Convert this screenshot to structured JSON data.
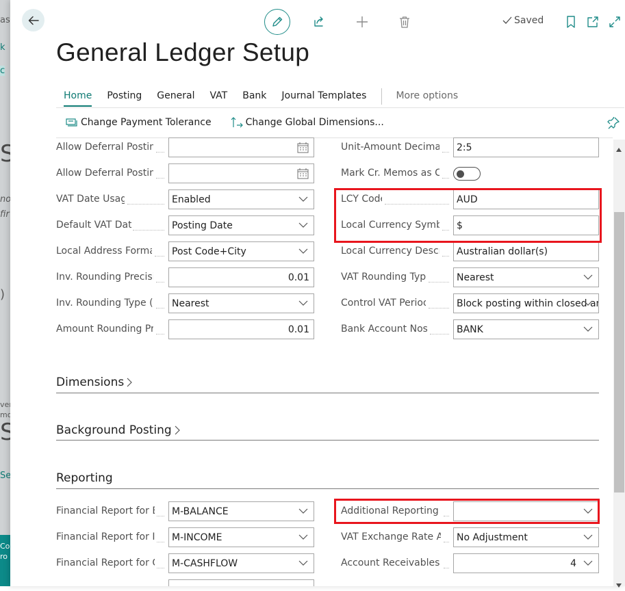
{
  "background": {
    "fragments": [
      "asl",
      "k",
      "c",
      "S",
      "no",
      "fir",
      ")",
      "ver",
      "mo",
      "S",
      "Se",
      "Co",
      "ro"
    ]
  },
  "header": {
    "saved_label": "Saved",
    "title": "General Ledger Setup"
  },
  "tabs": [
    {
      "label": "Home"
    },
    {
      "label": "Posting"
    },
    {
      "label": "General"
    },
    {
      "label": "VAT"
    },
    {
      "label": "Bank"
    },
    {
      "label": "Journal Templates"
    }
  ],
  "more_options": "More options",
  "actions": {
    "change_payment_tolerance": "Change Payment Tolerance",
    "change_global_dimensions": "Change Global Dimensions..."
  },
  "general_left": [
    {
      "label": "Allow Deferral Postin...",
      "value": "",
      "control": "date"
    },
    {
      "label": "Allow Deferral Postin...",
      "value": "",
      "control": "date"
    },
    {
      "label": "VAT Date Usage",
      "value": "Enabled",
      "control": "select"
    },
    {
      "label": "Default VAT Date",
      "value": "Posting Date",
      "control": "select"
    },
    {
      "label": "Local Address Format",
      "value": "Post Code+City",
      "control": "select"
    },
    {
      "label": "Inv. Rounding Precisi...",
      "value": "0.01",
      "control": "number"
    },
    {
      "label": "Inv. Rounding Type (L...",
      "value": "Nearest",
      "control": "select"
    },
    {
      "label": "Amount Rounding Pr...",
      "value": "0.01",
      "control": "number"
    }
  ],
  "general_right": [
    {
      "label": "Unit-Amount Decima...",
      "value": "2:5",
      "control": "text"
    },
    {
      "label": "Mark Cr. Memos as C...",
      "value": "",
      "control": "toggle"
    },
    {
      "label": "LCY Code",
      "value": "AUD",
      "control": "text"
    },
    {
      "label": "Local Currency Symbol",
      "value": "$",
      "control": "text"
    },
    {
      "label": "Local Currency Descri...",
      "value": "Australian dollar(s)",
      "control": "text"
    },
    {
      "label": "VAT Rounding Type",
      "value": "Nearest",
      "control": "select"
    },
    {
      "label": "Control VAT Period",
      "value": "Block posting within closed an",
      "control": "select"
    },
    {
      "label": "Bank Account Nos.",
      "value": "BANK",
      "control": "select"
    }
  ],
  "sections": {
    "dimensions": "Dimensions",
    "background_posting": "Background Posting",
    "reporting": "Reporting"
  },
  "reporting_left": [
    {
      "label": "Financial Report for B...",
      "value": "M-BALANCE",
      "control": "select"
    },
    {
      "label": "Financial Report for I...",
      "value": "M-INCOME",
      "control": "select"
    },
    {
      "label": "Financial Report for C...",
      "value": "M-CASHFLOW",
      "control": "select"
    }
  ],
  "reporting_right": [
    {
      "label": "Additional Reporting ...",
      "value": "",
      "control": "select"
    },
    {
      "label": "VAT Exchange Rate A...",
      "value": "No Adjustment",
      "control": "select"
    },
    {
      "label": "Account Receivables ...",
      "value": "4",
      "control": "number-select"
    }
  ],
  "colors": {
    "accent": "#0e7a73",
    "highlight": "#e8151d"
  }
}
